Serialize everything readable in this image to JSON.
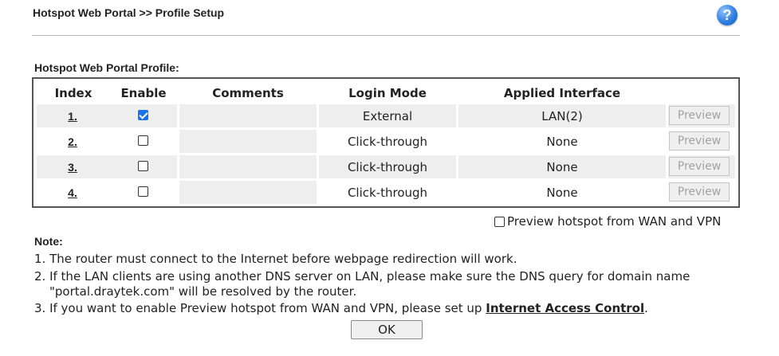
{
  "header": {
    "title": "Hotspot Web Portal >> Profile Setup",
    "help_icon": "question-mark-circle-icon",
    "help_glyph": "?"
  },
  "profile_section": {
    "title": "Hotspot Web Portal Profile:",
    "columns": {
      "index": "Index",
      "enable": "Enable",
      "comments": "Comments",
      "login_mode": "Login Mode",
      "applied_interface": "Applied Interface"
    },
    "rows": [
      {
        "index": "1.",
        "enabled": true,
        "comments": "",
        "login_mode": "External",
        "applied_interface": "LAN(2)",
        "preview_label": "Preview"
      },
      {
        "index": "2.",
        "enabled": false,
        "comments": "",
        "login_mode": "Click-through",
        "applied_interface": "None",
        "preview_label": "Preview"
      },
      {
        "index": "3.",
        "enabled": false,
        "comments": "",
        "login_mode": "Click-through",
        "applied_interface": "None",
        "preview_label": "Preview"
      },
      {
        "index": "4.",
        "enabled": false,
        "comments": "",
        "login_mode": "Click-through",
        "applied_interface": "None",
        "preview_label": "Preview"
      }
    ]
  },
  "preview_option": {
    "label": "Preview hotspot from WAN and VPN",
    "checked": false
  },
  "notes": {
    "title": "Note:",
    "line1": "1. The router must connect to the Internet before webpage redirection will work.",
    "line2a": "2. If the LAN clients are using another DNS server on LAN, please make sure the DNS query for domain name",
    "line2b": "\"portal.draytek.com\" will be resolved by the router.",
    "line3_prefix": "3. If you want to enable Preview hotspot from WAN and VPN, please set up ",
    "line3_link": "Internet Access Control",
    "line3_suffix": "."
  },
  "actions": {
    "ok_label": "OK"
  },
  "colors": {
    "checkbox_checked": "#1a73e8",
    "row_background": "#eeeeee",
    "disabled_text": "#a3a3a3"
  }
}
